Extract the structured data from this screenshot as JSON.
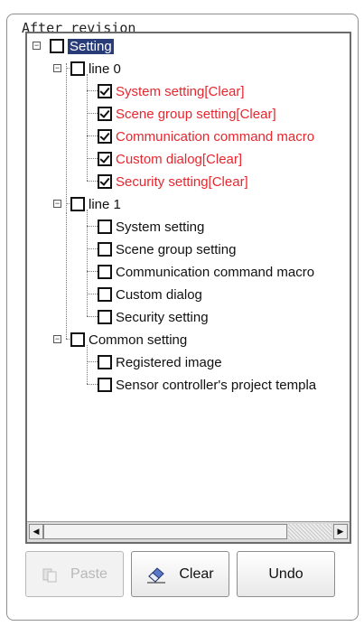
{
  "group_title": "After revision",
  "tree": {
    "root": {
      "label": "Setting",
      "checked": false,
      "selected": true
    },
    "groups": [
      {
        "label": "line 0",
        "items": [
          {
            "label": "System setting[Clear]",
            "checked": true,
            "modified": true
          },
          {
            "label": "Scene group setting[Clear]",
            "checked": true,
            "modified": true
          },
          {
            "label": "Communication command macro",
            "checked": true,
            "modified": true
          },
          {
            "label": "Custom dialog[Clear]",
            "checked": true,
            "modified": true
          },
          {
            "label": "Security setting[Clear]",
            "checked": true,
            "modified": true
          }
        ]
      },
      {
        "label": "line 1",
        "items": [
          {
            "label": "System setting",
            "checked": false
          },
          {
            "label": "Scene group setting",
            "checked": false
          },
          {
            "label": "Communication command macro",
            "checked": false
          },
          {
            "label": "Custom dialog",
            "checked": false
          },
          {
            "label": "Security setting",
            "checked": false
          }
        ]
      },
      {
        "label": "Common setting",
        "items": [
          {
            "label": "Registered image",
            "checked": false
          },
          {
            "label": "Sensor controller's project templa",
            "checked": false
          }
        ]
      }
    ]
  },
  "buttons": {
    "paste": "Paste",
    "clear": "Clear",
    "undo": "Undo"
  },
  "colors": {
    "modified_text": "#e8262e",
    "selection": "#283c78"
  },
  "icons": {
    "expanders": "minus-box-icon",
    "paste": "paste-icon",
    "clear": "eraser-icon"
  }
}
